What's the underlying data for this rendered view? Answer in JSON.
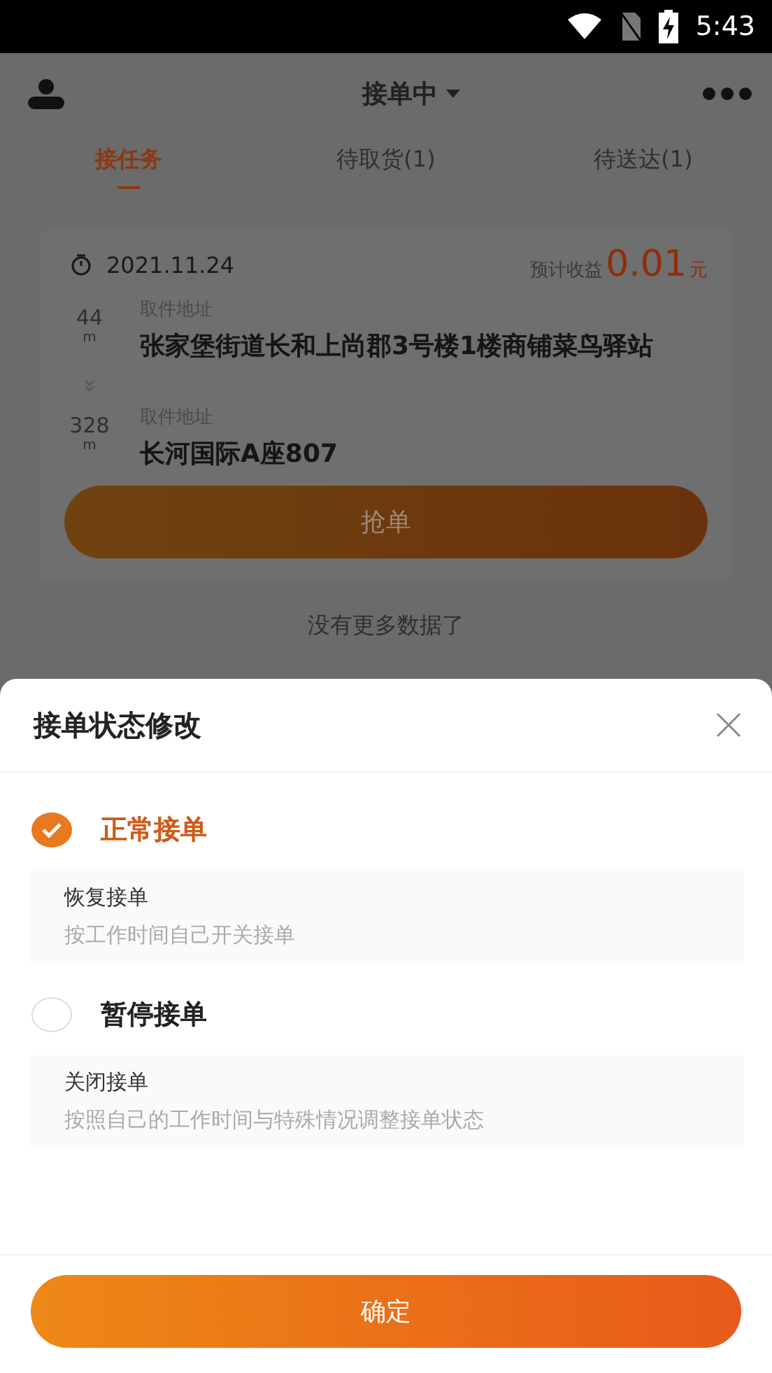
{
  "status_bar": {
    "time": "5:43"
  },
  "header": {
    "title": "接单中"
  },
  "tabs": [
    {
      "label": "接任务",
      "selected": true
    },
    {
      "label": "待取货(1)",
      "selected": false
    },
    {
      "label": "待送达(1)",
      "selected": false
    }
  ],
  "order": {
    "date": "2021.11.24",
    "earnings_label": "预计收益",
    "earnings_amount": "0.01",
    "earnings_unit": "元",
    "stops": [
      {
        "distance": "44",
        "unit": "m",
        "label": "取件地址",
        "address": "张家堡街道长和上尚郡3号楼1楼商铺菜鸟驿站"
      },
      {
        "distance": "328",
        "unit": "m",
        "label": "取件地址",
        "address": "长河国际A座807"
      }
    ],
    "action": "抢单"
  },
  "footer_note": "没有更多数据了",
  "sheet": {
    "title": "接单状态修改",
    "options": [
      {
        "label": "正常接单",
        "selected": true,
        "description_title": "恢复接单",
        "description": "按工作时间自己开关接单"
      },
      {
        "label": "暂停接单",
        "selected": false,
        "description_title": "关闭接单",
        "description": "按照自己的工作时间与特殊情况调整接单状态"
      }
    ],
    "confirm": "确定"
  }
}
